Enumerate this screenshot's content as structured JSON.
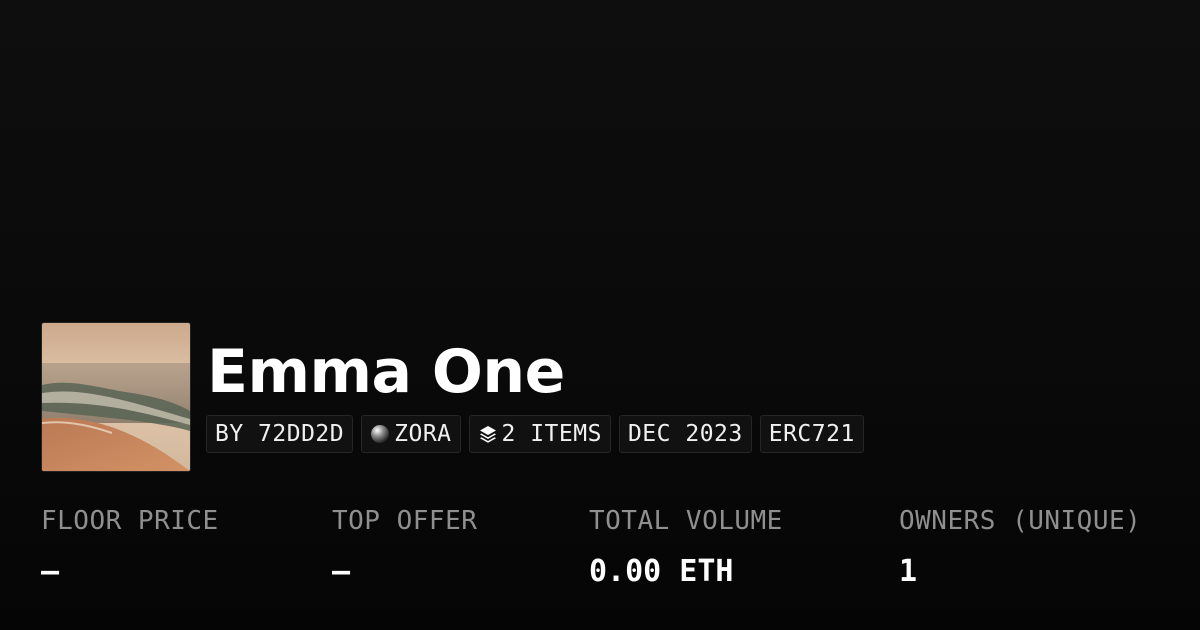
{
  "collection": {
    "title": "Emma One",
    "thumbnail_icon": "ocean-landscape-image"
  },
  "tags": {
    "creator": "BY 72DD2D",
    "chain": "ZORA",
    "chain_icon": "zora-orb-icon",
    "items": "2 ITEMS",
    "items_icon": "layers-icon",
    "date": "DEC 2023",
    "standard": "ERC721"
  },
  "stats": [
    {
      "label": "FLOOR PRICE",
      "value": "–"
    },
    {
      "label": "TOP OFFER",
      "value": "–"
    },
    {
      "label": "TOTAL VOLUME",
      "value": "0.00 ETH"
    },
    {
      "label": "OWNERS (UNIQUE)",
      "value": "1"
    }
  ]
}
